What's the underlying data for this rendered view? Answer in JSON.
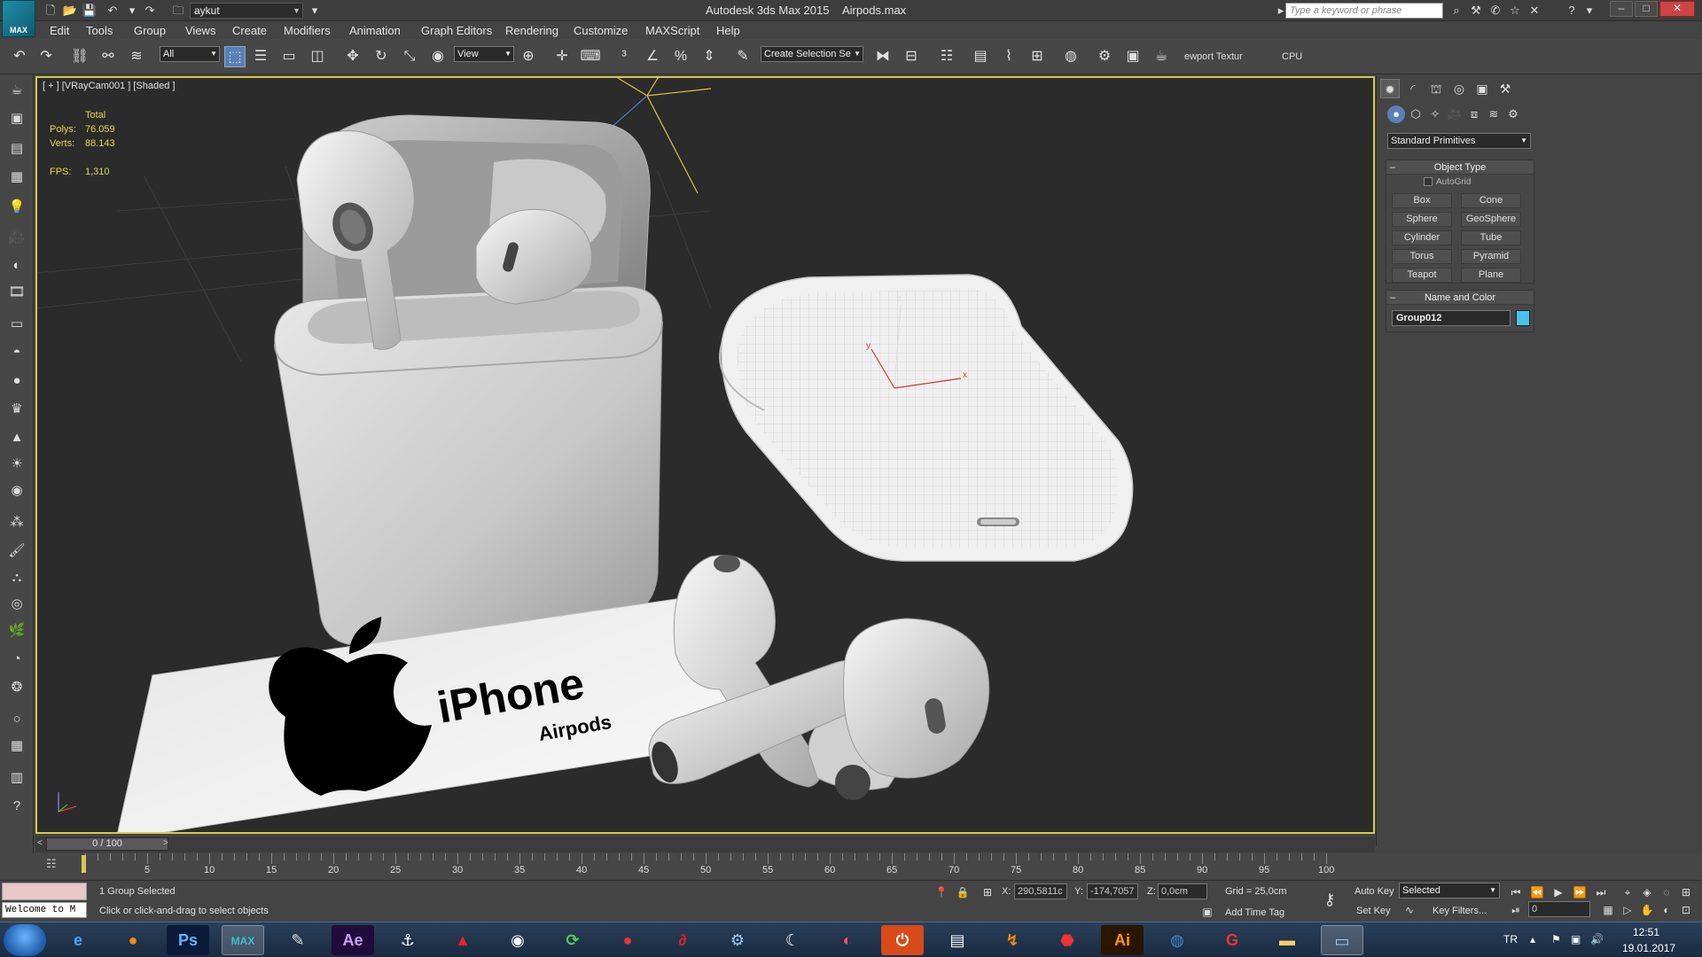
{
  "window": {
    "app_title": "Autodesk 3ds Max  2015",
    "file_name": "Airpods.max",
    "project": "aykut",
    "search_placeholder": "Type a keyword or phrase",
    "logo_label": "MAX"
  },
  "menu": [
    "Edit",
    "Tools",
    "Group",
    "Views",
    "Create",
    "Modifiers",
    "Animation",
    "Graph Editors",
    "Rendering",
    "Customize",
    "MAXScript",
    "Help"
  ],
  "toolbar": {
    "selection_filter": "All",
    "ref_coord": "View",
    "named_selection": "Create Selection Se",
    "viewport_texture": "ewport Textur",
    "cpu_label": "CPU"
  },
  "viewport": {
    "label": "[ + ] [VRayCam001 ] [Shaded ]",
    "stats_header": "Total",
    "polys_label": "Polys:",
    "polys_value": "76.059",
    "verts_label": "Verts:",
    "verts_value": "88.143",
    "fps_label": "FPS:",
    "fps_value": "1,310",
    "card_brand": "iPhone",
    "card_sub": "Airpods",
    "gizmo_axes": [
      "z",
      "y",
      "x"
    ]
  },
  "command_panel": {
    "category": "Standard Primitives",
    "object_type_title": "Object Type",
    "autogrid": "AutoGrid",
    "primitives": [
      "Box",
      "Cone",
      "Sphere",
      "GeoSphere",
      "Cylinder",
      "Tube",
      "Torus",
      "Pyramid",
      "Teapot",
      "Plane"
    ],
    "name_color_title": "Name and Color",
    "object_name": "Group012",
    "object_color": "#49c3e8"
  },
  "timeline": {
    "frame_display": "0 / 100",
    "ticks": [
      "5",
      "10",
      "15",
      "20",
      "25",
      "30",
      "35",
      "40",
      "45",
      "50",
      "55",
      "60",
      "65",
      "70",
      "75",
      "80",
      "85",
      "90",
      "95",
      "100"
    ]
  },
  "status": {
    "listener_text": "Welcome to M",
    "selection_status": "1 Group Selected",
    "prompt": "Click or click-and-drag to select objects",
    "x_label": "X:",
    "x_value": "290,5811c",
    "y_label": "Y:",
    "y_value": "-174,7057",
    "z_label": "Z:",
    "z_value": "0,0cm",
    "grid": "Grid = 25,0cm",
    "add_time_tag": "Add Time Tag",
    "auto_key": "Auto Key",
    "set_key": "Set Key",
    "key_mode": "Selected",
    "key_filters": "Key Filters...",
    "frame_field": "0"
  },
  "taskbar": {
    "language": "TR",
    "time": "12:51",
    "date": "19.01.2017",
    "apps": [
      "Ps",
      "MAX",
      "Ae",
      "Ai"
    ]
  }
}
